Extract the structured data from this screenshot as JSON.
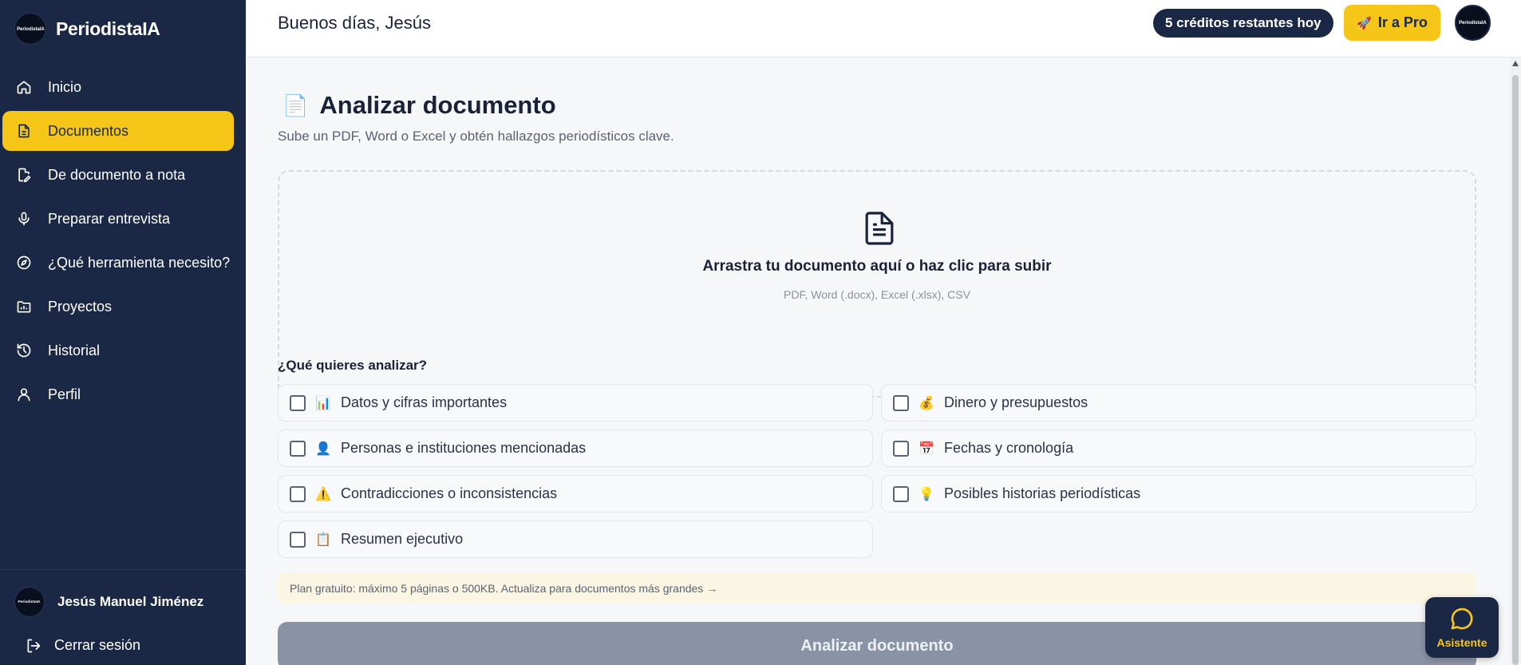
{
  "brand": {
    "name": "PeriodistaIA",
    "logo_text": "PeriodistaIA"
  },
  "sidebar": {
    "items": [
      {
        "label": "Inicio",
        "icon": "home-icon"
      },
      {
        "label": "Documentos",
        "icon": "document-icon",
        "active": true
      },
      {
        "label": "De documento a nota",
        "icon": "document-edit-icon"
      },
      {
        "label": "Preparar entrevista",
        "icon": "microphone-icon"
      },
      {
        "label": "¿Qué herramienta necesito?",
        "icon": "compass-icon"
      },
      {
        "label": "Proyectos",
        "icon": "chart-folder-icon"
      },
      {
        "label": "Historial",
        "icon": "history-icon"
      },
      {
        "label": "Perfil",
        "icon": "user-icon"
      }
    ],
    "user": {
      "name": "Jesús Manuel Jiménez",
      "avatar_text": "PeriodistaIA"
    },
    "logout_label": "Cerrar sesión"
  },
  "header": {
    "greeting": "Buenos días, Jesús",
    "credits": "5 créditos restantes hoy",
    "pro_label": "Ir a Pro",
    "pro_icon": "rocket-icon",
    "avatar_text": "PeriodistaIA"
  },
  "main": {
    "title": "Analizar documento",
    "title_icon": "📄",
    "subtitle": "Sube un PDF, Word o Excel y obtén hallazgos periodísticos clave.",
    "dropzone": {
      "text": "Arrastra tu documento aquí o haz clic para subir",
      "hint": "PDF, Word (.docx), Excel (.xlsx), CSV"
    },
    "question": "¿Qué quieres analizar?",
    "options": [
      {
        "emoji": "📊",
        "label": "Datos y cifras importantes",
        "checked": false
      },
      {
        "emoji": "💰",
        "label": "Dinero y presupuestos",
        "checked": false
      },
      {
        "emoji": "👤",
        "label": "Personas e instituciones mencionadas",
        "checked": false
      },
      {
        "emoji": "📅",
        "label": "Fechas y cronología",
        "checked": false
      },
      {
        "emoji": "⚠️",
        "label": "Contradicciones o inconsistencias",
        "checked": false
      },
      {
        "emoji": "💡",
        "label": "Posibles historias periodísticas",
        "checked": false
      },
      {
        "emoji": "📋",
        "label": "Resumen ejecutivo",
        "checked": false
      }
    ],
    "notice": "Plan gratuito: máximo 5 páginas o 500KB. Actualiza para documentos más grandes →",
    "analyze_label": "Analizar documento"
  },
  "assistant": {
    "label": "Asistente",
    "icon": "chat-bubble-icon"
  },
  "colors": {
    "sidebar_bg": "#1b2845",
    "accent": "#f5c518",
    "button_disabled": "#8a93a6",
    "notice_bg": "#fbf6e4"
  }
}
